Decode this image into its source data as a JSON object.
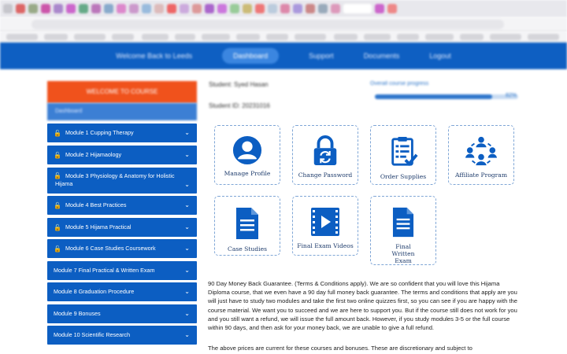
{
  "site_nav": {
    "items": [
      "Welcome Back to Leeds",
      "Dashboard",
      "Support",
      "Documents",
      "Logout"
    ]
  },
  "sidebar": {
    "welcome": "WELCOME TO COURSE",
    "sub": "Dashboard",
    "modules": [
      {
        "label": "Module 1 Cupping Therapy",
        "locked": true
      },
      {
        "label": "Module 2 Hijamaology",
        "locked": true
      },
      {
        "label": "Module 3 Physiology & Anatomy for Holistic Hijama",
        "locked": true
      },
      {
        "label": "Module 4 Best Practices",
        "locked": true
      },
      {
        "label": "Module 5 Hijama Practical",
        "locked": true
      },
      {
        "label": "Module 6 Case Studies Coursework",
        "locked": true
      },
      {
        "label": "Module 7 Final Practical & Written Exam",
        "locked": false
      },
      {
        "label": "Module 8 Graduation Procedure",
        "locked": false
      },
      {
        "label": "Module 9 Bonuses",
        "locked": false
      },
      {
        "label": "Module 10 Scientific Research",
        "locked": false
      }
    ]
  },
  "student": {
    "name_line": "Student: Syed Hasan",
    "id_line": "Student ID: 20231016",
    "progress_label": "Overall course progress",
    "progress_pct": "82%",
    "progress_fraction": 0.82
  },
  "tiles": [
    {
      "label": "Manage Profile",
      "icon": "user-icon"
    },
    {
      "label": "Change Password",
      "icon": "lock-refresh-icon"
    },
    {
      "label": "Order Supplies",
      "icon": "clipboard-check-icon"
    },
    {
      "label": "Affiliate Program",
      "icon": "network-people-icon"
    },
    {
      "label": "Case Studies",
      "icon": "document-icon"
    },
    {
      "label": "Final Exam Videos",
      "icon": "film-play-icon"
    },
    {
      "label": "Final Written Exam",
      "icon": "document-icon"
    }
  ],
  "content": {
    "guarantee": "90 Day Money Back Guarantee. (Terms & Conditions apply). We are so confident that you will love this Hijama Diploma course, that we even have a 90 day full money back guarantee. The terms and conditions that apply are you will just have to study two modules and take the first two online quizzes first, so you can see if you are happy with the course material. We want you to succeed and we are here to support you. But if the course still does not work for you and you still want a refund, we will issue the full amount back. However, if you study modules 3-5 or the full course within 90 days, and then ask for your money back, we are unable to give a full refund.",
    "prices": "The above prices are current for these courses and bonuses. These are discretionary and subject to"
  },
  "colors": {
    "brand_blue": "#0c5ec2",
    "accent_orange": "#f0521c",
    "icon_blue": "#0c5ec2"
  }
}
